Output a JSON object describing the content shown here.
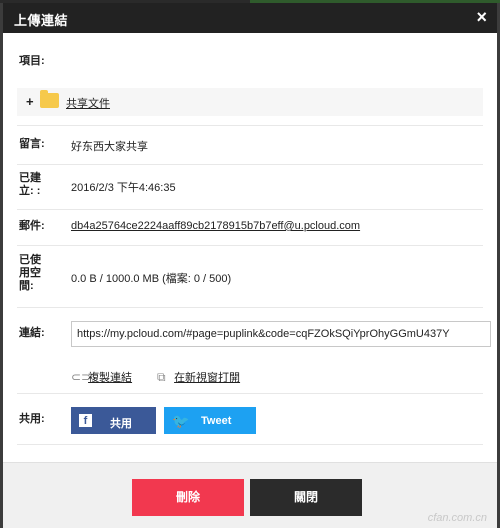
{
  "dialog": {
    "title": "上傳連結",
    "close": "×"
  },
  "fields": {
    "items_label": "項目:",
    "folder": {
      "expand": "+",
      "name": "共享文件"
    },
    "message_label": "留言:",
    "message_value": "好东西大家共享",
    "created_label_1": "已建",
    "created_label_2": "立: :",
    "created_value": "2016/2/3 下午4:46:35",
    "email_label": "郵件:",
    "email_value": "db4a25764ce2224aaff89cb2178915b7b7eff@u.pcloud.com",
    "used_label_1": "已使",
    "used_label_2": "用空",
    "used_label_3": "間:",
    "used_value": "0.0 B / 1000.0 MB (檔案: 0 / 500)",
    "link_label": "連結:",
    "link_value": "https://my.pcloud.com/#page=puplink&code=cqFZOkSQiYprOhyGGmU437Y",
    "copy_link": "複製連結",
    "open_new": "在新視窗打開",
    "share_label": "共用:"
  },
  "share": {
    "facebook": "共用",
    "twitter": "Tweet"
  },
  "footer": {
    "delete": "刪除",
    "close": "關閉"
  },
  "watermark": "cfan.com.cn",
  "colors": {
    "title_bg": "#222222",
    "delete": "#f2384f",
    "close": "#2b2b2b",
    "facebook": "#3b5998",
    "twitter": "#1da1f2",
    "folder": "#f6c94b"
  },
  "icons": [
    "close-icon",
    "plus-icon",
    "folder-icon",
    "link-icon",
    "external-window-icon",
    "facebook-icon",
    "twitter-icon"
  ]
}
